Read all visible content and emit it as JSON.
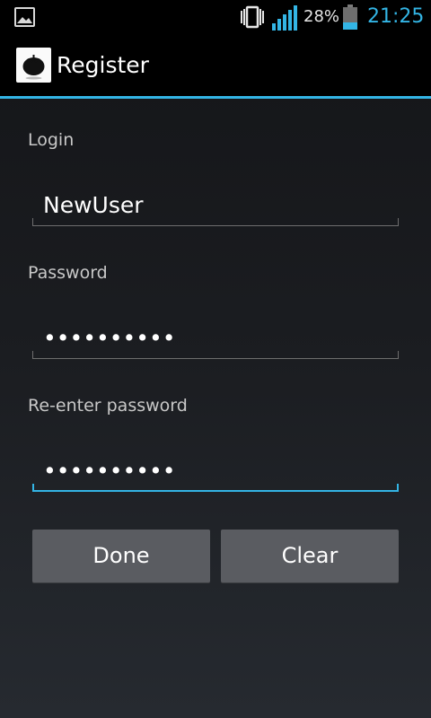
{
  "status_bar": {
    "battery_percent": "28%",
    "time": "21:25",
    "icons": [
      "gallery-icon",
      "vibrate-icon",
      "signal-icon",
      "battery-icon"
    ],
    "battery_level": 0.28,
    "time_color": "#33b5e5"
  },
  "action_bar": {
    "title": "Register",
    "icon": "tomato-icon",
    "accent_color": "#33b5e5"
  },
  "form": {
    "login": {
      "label": "Login",
      "value": "NewUser"
    },
    "password": {
      "label": "Password",
      "value": "••••••••••"
    },
    "reenter_password": {
      "label": "Re-enter password",
      "value": "••••••••••",
      "focused": true
    }
  },
  "buttons": {
    "done_label": "Done",
    "clear_label": "Clear"
  }
}
